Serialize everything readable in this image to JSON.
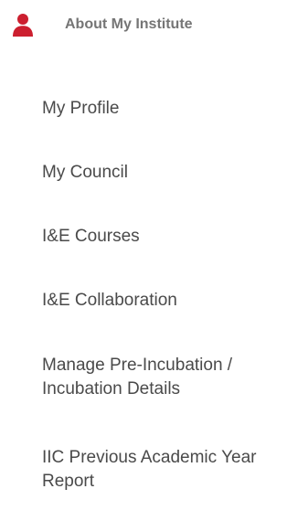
{
  "header": {
    "icon": "user-icon",
    "label": "About My Institute",
    "icon_color": "#cc1f2f"
  },
  "menu": {
    "items": [
      {
        "label": "My Profile"
      },
      {
        "label": "My Council"
      },
      {
        "label": "I&E Courses"
      },
      {
        "label": "I&E Collaboration"
      },
      {
        "label": "Manage Pre-Incubation / Incubation Details"
      },
      {
        "label": "IIC Previous Academic Year Report"
      }
    ]
  }
}
